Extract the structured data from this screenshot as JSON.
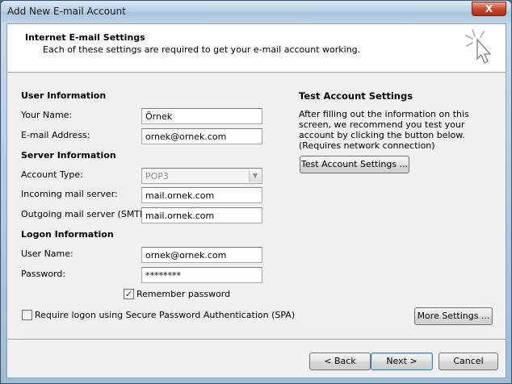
{
  "window": {
    "title": "Add New E-mail Account",
    "close_label": "X"
  },
  "header": {
    "title": "Internet E-mail Settings",
    "subtitle": "Each of these settings are required to get your e-mail account working."
  },
  "user_info": {
    "heading": "User Information",
    "name_label": "Your Name:",
    "name_value": "Örnek",
    "email_label": "E-mail Address:",
    "email_value": "ornek@ornek.com"
  },
  "server_info": {
    "heading": "Server Information",
    "account_type_label": "Account Type:",
    "account_type_value": "POP3",
    "incoming_label": "Incoming mail server:",
    "incoming_value": "mail.ornek.com",
    "outgoing_label": "Outgoing mail server (SMTP):",
    "outgoing_value": "mail.ornek.com"
  },
  "logon_info": {
    "heading": "Logon Information",
    "username_label": "User Name:",
    "username_value": "ornek@ornek.com",
    "password_label": "Password:",
    "password_value": "********",
    "remember_label": "Remember password",
    "remember_checked": true,
    "spa_label": "Require logon using Secure Password Authentication (SPA)",
    "spa_checked": false
  },
  "test_settings": {
    "heading": "Test Account Settings",
    "description": "After filling out the information on this screen, we recommend you test your account by clicking the button below. (Requires network connection)",
    "button_label": "Test Account Settings ..."
  },
  "buttons": {
    "more_settings": "More Settings ...",
    "back": "< Back",
    "next": "Next >",
    "cancel": "Cancel"
  },
  "icons": {
    "check_glyph": "✓",
    "combo_glyph": "▼"
  }
}
